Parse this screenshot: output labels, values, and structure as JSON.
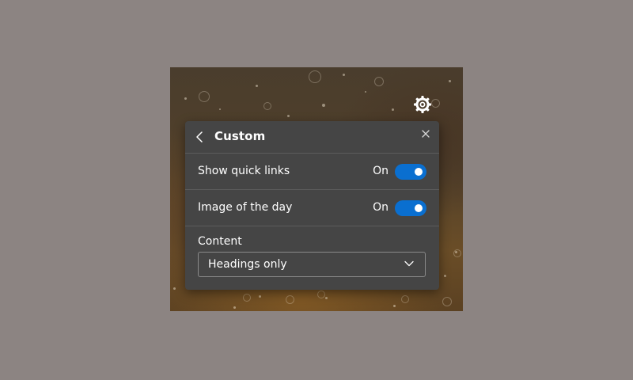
{
  "background": {
    "description_icon": "bokeh-photo",
    "accent": "#6a4d27"
  },
  "settings_button": {
    "icon": "gear-icon"
  },
  "panel": {
    "back_icon": "chevron-left-icon",
    "title": "Custom",
    "close_icon": "close-icon",
    "rows": [
      {
        "label": "Show quick links",
        "state": "On",
        "enabled": true
      },
      {
        "label": "Image of the day",
        "state": "On",
        "enabled": true
      }
    ],
    "content": {
      "label": "Content",
      "selected": "Headings only",
      "chevron_icon": "chevron-down-icon"
    }
  },
  "colors": {
    "page_background": "#8c8482",
    "panel_background": "#454545",
    "toggle_on": "#0a6fd0",
    "divider": "#5c5c5c"
  }
}
